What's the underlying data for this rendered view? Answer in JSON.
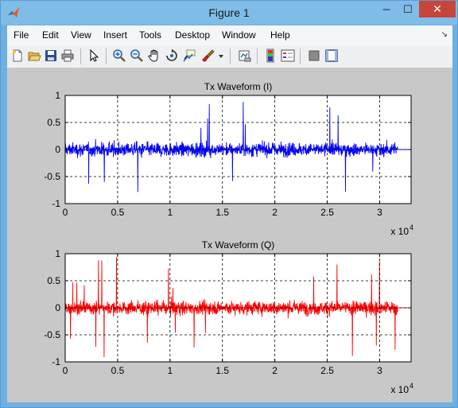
{
  "window": {
    "title": "Figure 1",
    "minimize": "─",
    "maximize": "☐",
    "close": "✕"
  },
  "menu": {
    "items": [
      "File",
      "Edit",
      "View",
      "Insert",
      "Tools",
      "Desktop",
      "Window",
      "Help"
    ],
    "overflow": "↘"
  },
  "toolbar": {
    "icons": [
      "new-figure-icon",
      "open-icon",
      "save-icon",
      "print-icon",
      "pointer-icon",
      "zoom-in-icon",
      "zoom-out-icon",
      "pan-icon",
      "rotate-3d-icon",
      "data-cursor-icon",
      "brush-icon",
      "brush-dropdown-icon",
      "link-plot-icon",
      "insert-colorbar-icon",
      "insert-legend-icon",
      "hide-plot-tools-icon",
      "show-plot-tools-icon"
    ]
  },
  "chart_data": [
    {
      "type": "line",
      "title": "Tx Waveform (I)",
      "xlabel": "",
      "ylabel": "",
      "x_exponent_label": "x 10",
      "x_exponent": "4",
      "xlim": [
        0,
        3.3
      ],
      "ylim": [
        -1,
        1
      ],
      "xticks": [
        "0",
        "0.5",
        "1",
        "1.5",
        "2",
        "2.5",
        "3"
      ],
      "yticks": [
        "1",
        "0.5",
        "0",
        "-0.5",
        "-1"
      ],
      "grid": true,
      "color": "#0000ff",
      "series": [
        {
          "x_range": [
            0,
            3.17
          ],
          "typical_amplitude": 0.35,
          "peak_amplitude": 0.95,
          "x_end": 3.3,
          "tail_value": 0
        }
      ]
    },
    {
      "type": "line",
      "title": "Tx Waveform (Q)",
      "xlabel": "",
      "ylabel": "",
      "x_exponent_label": "x 10",
      "x_exponent": "4",
      "xlim": [
        0,
        3.3
      ],
      "ylim": [
        -1,
        1
      ],
      "xticks": [
        "0",
        "0.5",
        "1",
        "1.5",
        "2",
        "2.5",
        "3"
      ],
      "yticks": [
        "1",
        "0.5",
        "0",
        "-0.5",
        "-1"
      ],
      "grid": true,
      "color": "#ff0000",
      "series": [
        {
          "x_range": [
            0,
            3.17
          ],
          "typical_amplitude": 0.35,
          "peak_amplitude": 0.98,
          "x_end": 3.3,
          "tail_value": 0
        }
      ]
    }
  ]
}
